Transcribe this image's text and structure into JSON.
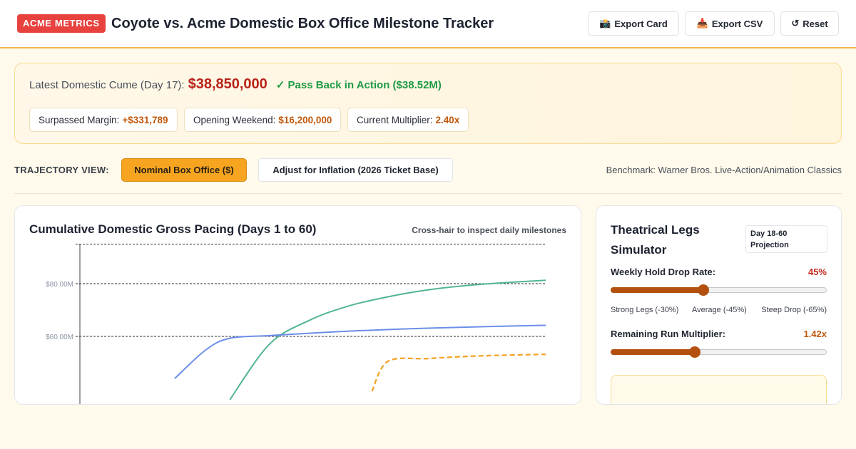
{
  "header": {
    "brand": "ACME METRICS",
    "title": "Coyote vs. Acme Domestic Box Office Milestone Tracker",
    "buttons": [
      {
        "icon": "camera-icon",
        "glyph": "📸",
        "label": "Export Card"
      },
      {
        "icon": "inbox-tray-icon",
        "glyph": "📥",
        "label": "Export CSV"
      },
      {
        "icon": "reset-arrow-icon",
        "glyph": "↺",
        "label": "Reset"
      }
    ]
  },
  "summary": {
    "cume_label": "Latest Domestic Cume (Day 17):",
    "cume_value": "$38,850,000",
    "status": "✓ Pass Back in Action ($38.52M)",
    "status_color": "#1f9a45",
    "pills": [
      {
        "label": "Surpassed Margin:",
        "value": "+$331,789"
      },
      {
        "label": "Opening Weekend:",
        "value": "$16,200,000"
      },
      {
        "label": "Current Multiplier:",
        "value": "2.40x"
      }
    ]
  },
  "trajectory": {
    "label": "TRAJECTORY VIEW:",
    "options": [
      "Nominal Box Office ($)",
      "Adjust for Inflation (2026 Ticket Base)"
    ],
    "active": 0,
    "benchmark": "Benchmark: Warner Bros. Live-Action/Animation Classics"
  },
  "chart": {
    "title": "Cumulative Domestic Gross Pacing (Days 1 to 60)",
    "hint": "Cross-hair to inspect daily milestones"
  },
  "chart_data": {
    "type": "line",
    "title": "Cumulative Domestic Gross Pacing (Days 1 to 60)",
    "xlim": [
      1,
      60
    ],
    "ylim": [
      0,
      95
    ],
    "y_ticks": [
      60,
      80
    ],
    "y_tick_labels": [
      "$60.00M",
      "$80.00M"
    ],
    "grid": true,
    "series": [
      {
        "color": "#52b592",
        "style": "solid",
        "x": [
          20,
          25,
          30,
          35,
          40,
          45,
          50,
          55,
          60
        ],
        "y": [
          36,
          57,
          66,
          71.5,
          75,
          77.6,
          79.3,
          80.4,
          81.3
        ]
      },
      {
        "color": "#6b8ee8",
        "style": "solid",
        "x": [
          13,
          17,
          20,
          25,
          30,
          35,
          40,
          45,
          50,
          55,
          60
        ],
        "y": [
          44,
          55,
          59.3,
          60.3,
          61.2,
          62,
          62.6,
          63.1,
          63.5,
          63.9,
          64.2
        ]
      },
      {
        "color": "#f2a122",
        "style": "dashed",
        "x": [
          38,
          40,
          45,
          50,
          55,
          60
        ],
        "y": [
          39.2,
          50.5,
          51.6,
          52.4,
          52.9,
          53.2
        ]
      }
    ]
  },
  "simulator": {
    "title": "Theatrical Legs Simulator",
    "badge": "Day 18-60 Projection",
    "drop_label": "Weekly Hold Drop Rate:",
    "drop_value": "45%",
    "drop_fraction": 0.43,
    "drop_scale": [
      "Strong Legs (-30%)",
      "Average (-45%)",
      "Steep Drop (-65%)"
    ],
    "mult_label": "Remaining Run Multiplier:",
    "mult_value": "1.42x",
    "mult_fraction": 0.39,
    "value_color_drop": "#c62b20",
    "value_color_mult": "#c0580c"
  }
}
